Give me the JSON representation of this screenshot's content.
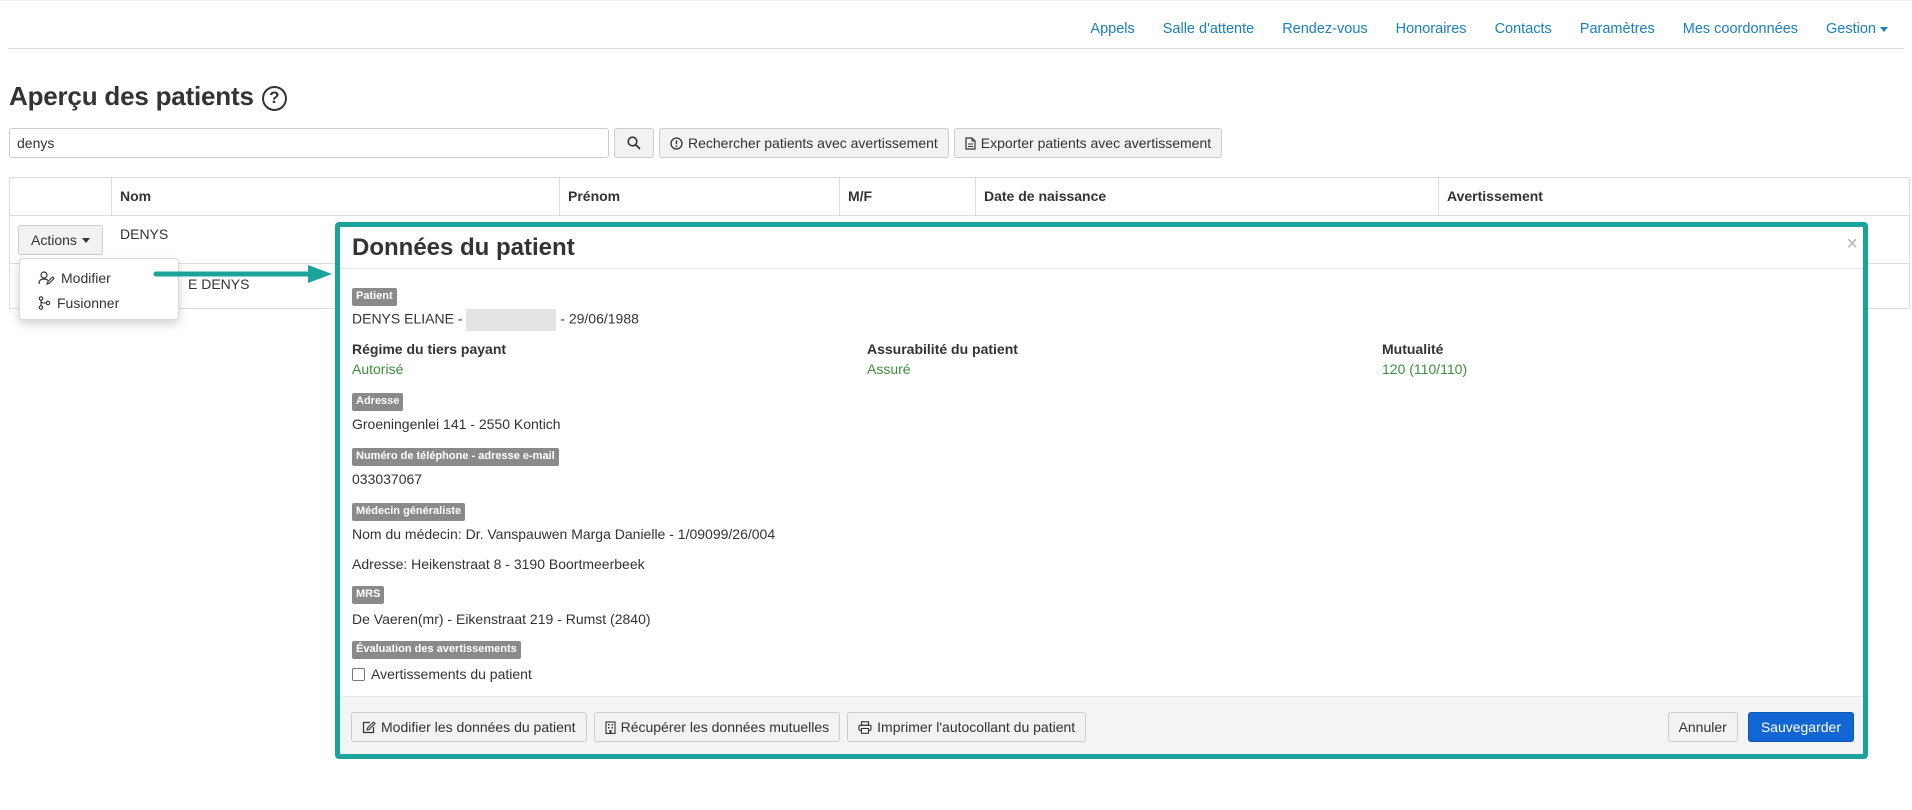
{
  "nav": {
    "items": [
      "Appels",
      "Salle d'attente",
      "Rendez-vous",
      "Honoraires",
      "Contacts",
      "Paramètres",
      "Mes coordonnées",
      "Gestion"
    ]
  },
  "page": {
    "title": "Aperçu des patients",
    "help_glyph": "?"
  },
  "search": {
    "value": "denys",
    "warn_search_label": "Rechercher patients avec avertissement",
    "export_label": "Exporter patients avec avertissement"
  },
  "table": {
    "headers": [
      "",
      "Nom",
      "Prénom",
      "M/F",
      "Date de naissance",
      "Avertissement"
    ],
    "rows": [
      {
        "nom": "DENYS"
      },
      {
        "nom_partial": "E DENYS"
      }
    ],
    "actions_label": "Actions"
  },
  "dropdown": {
    "items": [
      "Modifier",
      "Fusionner"
    ]
  },
  "modal": {
    "title": "Données du patient",
    "close": "×",
    "patient_label": "Patient",
    "patient_name": "DENYS ELIANE -",
    "patient_dob": "- 29/06/1988",
    "regime_title": "Régime du tiers payant",
    "regime_value": "Autorisé",
    "assurabilite_title": "Assurabilité du patient",
    "assurabilite_value": "Assuré",
    "mutualite_title": "Mutualité",
    "mutualite_value": "120 (110/110)",
    "adresse_label": "Adresse",
    "adresse_value": "Groeningenlei 141 - 2550 Kontich",
    "phone_label": "Numéro de téléphone - adresse e-mail",
    "phone_value": "033037067",
    "medecin_label": "Médecin généraliste",
    "medecin_name": "Nom du médecin: Dr. Vanspauwen Marga Danielle - 1/09099/26/004",
    "medecin_address": "Adresse: Heikenstraat 8 - 3190 Boortmeerbeek",
    "mrs_label": "MRS",
    "mrs_value": "De Vaeren(mr) - Eikenstraat 219 - Rumst (2840)",
    "eval_label": "Évaluation des avertissements",
    "warnings_checkbox": "Avertissements du patient",
    "btn_modifier": "Modifier les données du patient",
    "btn_recuperer": "Récupérer les données mutuelles",
    "btn_imprimer": "Imprimer l'autocollant du patient",
    "btn_annuler": "Annuler",
    "btn_sauvegarder": "Sauvegarder"
  },
  "colors": {
    "accent": "#1aa39a",
    "link": "#1a7fc1",
    "primary": "#1166d4",
    "success": "#3c8f3c"
  }
}
